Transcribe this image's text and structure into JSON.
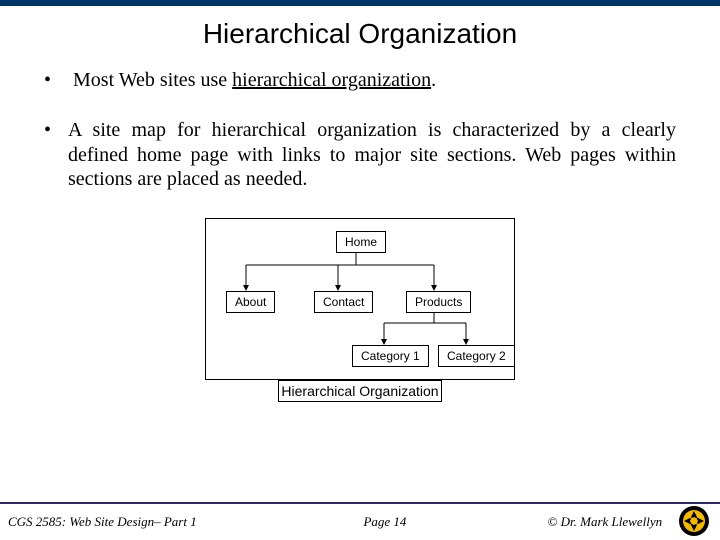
{
  "title": "Hierarchical Organization",
  "bullets": {
    "b1a": "Most Web sites use ",
    "b1b": "hierarchical organization",
    "b1c": ".",
    "b2": "A site map for hierarchical organization is characterized by a clearly defined home page with links to major site sections. Web pages within sections are placed as needed."
  },
  "diagram": {
    "home": "Home",
    "about": "About",
    "contact": "Contact",
    "products": "Products",
    "cat1": "Category 1",
    "cat2": "Category 2"
  },
  "caption": "Hierarchical Organization",
  "footer": {
    "left": "CGS 2585: Web Site Design– Part 1",
    "mid": "Page 14",
    "right": "© Dr. Mark Llewellyn"
  }
}
